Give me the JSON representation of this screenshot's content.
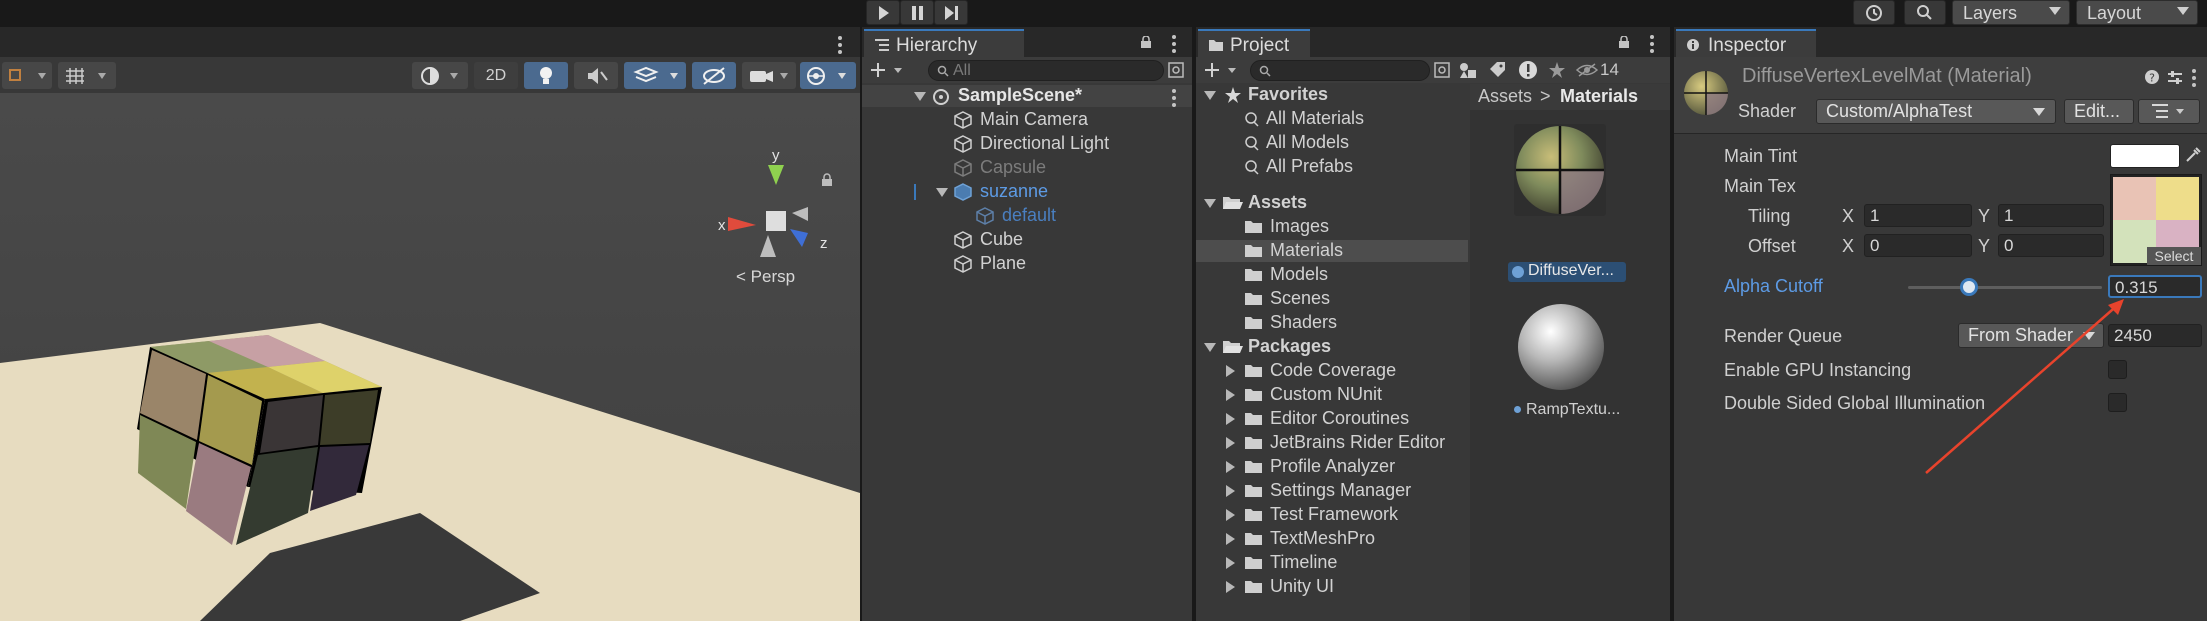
{
  "toolbar": {
    "play": "play",
    "pause": "pause",
    "step": "step",
    "layers_label": "Layers",
    "layout_label": "Layout"
  },
  "scene_view": {
    "button_2d": "2D",
    "axis_x": "x",
    "axis_y": "y",
    "axis_z": "z",
    "persp_label": "Persp"
  },
  "hierarchy": {
    "tab_label": "Hierarchy",
    "search_placeholder": "All",
    "scene_name": "SampleScene*",
    "items": [
      {
        "label": "Main Camera"
      },
      {
        "label": "Directional Light"
      },
      {
        "label": "Capsule"
      },
      {
        "label": "suzanne"
      },
      {
        "label": "default"
      },
      {
        "label": "Cube"
      },
      {
        "label": "Plane"
      }
    ]
  },
  "project": {
    "tab_label": "Project",
    "hidden_count": "14",
    "favorites": {
      "title": "Favorites",
      "items": [
        {
          "label": "All Materials"
        },
        {
          "label": "All Models"
        },
        {
          "label": "All Prefabs"
        }
      ]
    },
    "assets": {
      "title": "Assets",
      "items": [
        {
          "label": "Images"
        },
        {
          "label": "Materials"
        },
        {
          "label": "Models"
        },
        {
          "label": "Scenes"
        },
        {
          "label": "Shaders"
        }
      ]
    },
    "packages": {
      "title": "Packages",
      "items": [
        {
          "label": "Code Coverage"
        },
        {
          "label": "Custom NUnit"
        },
        {
          "label": "Editor Coroutines"
        },
        {
          "label": "JetBrains Rider Editor"
        },
        {
          "label": "Profile Analyzer"
        },
        {
          "label": "Settings Manager"
        },
        {
          "label": "Test Framework"
        },
        {
          "label": "TextMeshPro"
        },
        {
          "label": "Timeline"
        },
        {
          "label": "Unity UI"
        }
      ]
    },
    "breadcrumb": {
      "root": "Assets",
      "sep": ">",
      "current": "Materials"
    },
    "files": [
      {
        "label": "DiffuseVer..."
      },
      {
        "label": "RampTextu..."
      }
    ]
  },
  "inspector": {
    "tab_label": "Inspector",
    "material_title": "DiffuseVertexLevelMat (Material)",
    "shader_label": "Shader",
    "shader_value": "Custom/AlphaTest",
    "edit_button": "Edit...",
    "main_tint_label": "Main Tint",
    "main_tex_label": "Main Tex",
    "tiling_label": "Tiling",
    "offset_label": "Offset",
    "x_label": "X",
    "y_label": "Y",
    "tiling_x": "1",
    "tiling_y": "1",
    "offset_x": "0",
    "offset_y": "0",
    "select_label": "Select",
    "alpha_cutoff_label": "Alpha Cutoff",
    "alpha_cutoff_value": "0.315",
    "alpha_cutoff_slider_fraction": 0.315,
    "render_queue_label": "Render Queue",
    "render_queue_mode": "From Shader",
    "render_queue_value": "2450",
    "gpu_instancing_label": "Enable GPU Instancing",
    "double_sided_gi_label": "Double Sided Global Illumination"
  },
  "colors": {
    "accent_blue": "#3a79bb",
    "link_blue": "#5d9be5",
    "annotation_arrow": "#e8432c"
  }
}
